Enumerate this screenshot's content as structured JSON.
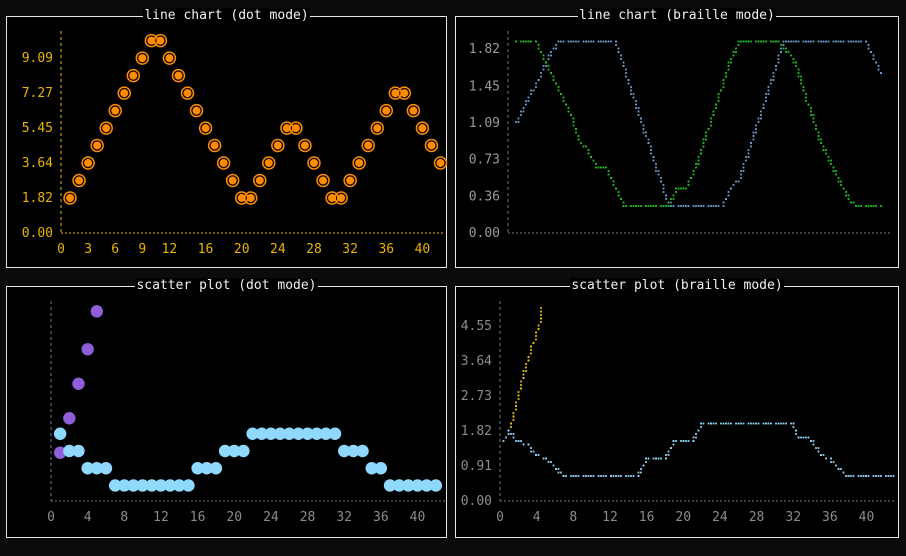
{
  "window": {
    "background": "#0b0b0c",
    "border": "#e6e6e6"
  },
  "panels": [
    {
      "title": "line chart (dot mode)",
      "chart_data": {
        "type": "line",
        "mode": "dot",
        "x": [
          1,
          2,
          3,
          4,
          5,
          6,
          7,
          8,
          9,
          10,
          11,
          12,
          13,
          14,
          15,
          16,
          17,
          18,
          19,
          20,
          21,
          22,
          23,
          24,
          25,
          26,
          27,
          28,
          29,
          30,
          31,
          32,
          33,
          34,
          35,
          36,
          37,
          38,
          39,
          40,
          41,
          42
        ],
        "series": [
          {
            "color": "#ff8c00",
            "values": [
              1.82,
              2.73,
              3.64,
              4.55,
              5.45,
              6.36,
              7.27,
              8.18,
              9.09,
              10.0,
              10.0,
              9.09,
              8.18,
              7.27,
              6.36,
              5.45,
              4.55,
              3.64,
              2.73,
              1.82,
              1.82,
              2.73,
              3.64,
              4.55,
              5.45,
              5.45,
              4.55,
              3.64,
              2.73,
              1.82,
              1.82,
              2.73,
              3.64,
              4.55,
              5.45,
              6.36,
              7.27,
              7.27,
              6.36,
              5.45,
              4.55,
              3.64
            ]
          }
        ],
        "x_ticks": [
          "0",
          "3",
          "6",
          "9",
          "12",
          "16",
          "20",
          "24",
          "28",
          "32",
          "36",
          "40"
        ],
        "x_tick_values": [
          0,
          3,
          6,
          9,
          12,
          16,
          20,
          24,
          28,
          32,
          36,
          40
        ],
        "y_ticks": [
          "0.00",
          "1.82",
          "3.64",
          "5.45",
          "7.27",
          "9.09"
        ],
        "y_tick_values": [
          0,
          1.82,
          3.64,
          5.45,
          7.27,
          9.09
        ],
        "xlim": [
          0,
          42.5
        ],
        "ylim": [
          0,
          10.5
        ],
        "axis_color": "#e8b400",
        "tick_color": "#e8b400"
      }
    },
    {
      "title": "line chart (braille mode)",
      "chart_data": {
        "type": "line",
        "mode": "braille",
        "x": [
          1,
          2,
          3,
          4,
          5,
          6,
          7,
          8,
          9,
          10,
          11,
          12,
          13,
          14,
          15,
          16,
          17,
          18,
          19,
          20,
          21,
          22,
          23,
          24,
          25,
          26,
          27,
          28,
          29,
          30,
          31,
          32,
          33,
          34,
          35,
          36,
          37,
          38,
          39,
          40,
          41,
          42
        ],
        "series": [
          {
            "color": "#6ea2d8",
            "values": [
              1.09,
              1.27,
              1.45,
              1.64,
              1.82,
              1.91,
              1.91,
              1.91,
              1.91,
              1.91,
              1.91,
              1.91,
              1.64,
              1.36,
              1.09,
              0.82,
              0.55,
              0.27,
              0.27,
              0.27,
              0.27,
              0.27,
              0.27,
              0.27,
              0.45,
              0.55,
              0.82,
              1.09,
              1.36,
              1.64,
              1.91,
              1.91,
              1.91,
              1.91,
              1.91,
              1.91,
              1.91,
              1.91,
              1.91,
              1.91,
              1.73,
              1.55
            ]
          },
          {
            "color": "#22c922",
            "values": [
              1.91,
              1.91,
              1.91,
              1.73,
              1.55,
              1.36,
              1.18,
              0.91,
              0.82,
              0.64,
              0.64,
              0.45,
              0.27,
              0.27,
              0.27,
              0.27,
              0.27,
              0.27,
              0.45,
              0.45,
              0.64,
              0.91,
              1.18,
              1.45,
              1.73,
              1.91,
              1.91,
              1.91,
              1.91,
              1.91,
              1.82,
              1.73,
              1.45,
              1.18,
              0.91,
              0.73,
              0.55,
              0.36,
              0.27,
              0.27,
              0.27,
              0.27
            ]
          }
        ],
        "y_ticks": [
          "0.00",
          "0.36",
          "0.73",
          "1.09",
          "1.45",
          "1.82"
        ],
        "y_tick_values": [
          0,
          0.36,
          0.73,
          1.09,
          1.45,
          1.82
        ],
        "xlim": [
          0,
          43
        ],
        "ylim": [
          0,
          2.0
        ],
        "axis_color": "#7a7a7a",
        "tick_color": "#9a9a9a"
      }
    },
    {
      "title": "scatter plot (dot mode)",
      "chart_data": {
        "type": "scatter",
        "mode": "dot",
        "series": [
          {
            "color": "#8e5fd9",
            "points": [
              [
                1,
                1.4
              ],
              [
                2,
                2.4
              ],
              [
                3,
                3.4
              ],
              [
                4,
                4.4
              ],
              [
                5,
                5.5
              ]
            ]
          },
          {
            "color": "#8fd9ff",
            "points": [
              [
                1,
                1.95
              ],
              [
                2,
                1.45
              ],
              [
                3,
                1.45
              ],
              [
                4,
                0.95
              ],
              [
                5,
                0.95
              ],
              [
                6,
                0.95
              ],
              [
                7,
                0.45
              ],
              [
                8,
                0.45
              ],
              [
                9,
                0.45
              ],
              [
                10,
                0.45
              ],
              [
                11,
                0.45
              ],
              [
                12,
                0.45
              ],
              [
                13,
                0.45
              ],
              [
                14,
                0.45
              ],
              [
                15,
                0.45
              ],
              [
                16,
                0.95
              ],
              [
                17,
                0.95
              ],
              [
                18,
                0.95
              ],
              [
                19,
                1.45
              ],
              [
                20,
                1.45
              ],
              [
                21,
                1.45
              ],
              [
                22,
                1.95
              ],
              [
                23,
                1.95
              ],
              [
                24,
                1.95
              ],
              [
                25,
                1.95
              ],
              [
                26,
                1.95
              ],
              [
                27,
                1.95
              ],
              [
                28,
                1.95
              ],
              [
                29,
                1.95
              ],
              [
                30,
                1.95
              ],
              [
                31,
                1.95
              ],
              [
                32,
                1.45
              ],
              [
                33,
                1.45
              ],
              [
                34,
                1.45
              ],
              [
                35,
                0.95
              ],
              [
                36,
                0.95
              ],
              [
                37,
                0.45
              ],
              [
                38,
                0.45
              ],
              [
                39,
                0.45
              ],
              [
                40,
                0.45
              ],
              [
                41,
                0.45
              ],
              [
                42,
                0.45
              ]
            ]
          }
        ],
        "x_ticks": [
          "0",
          "4",
          "8",
          "12",
          "16",
          "20",
          "24",
          "28",
          "32",
          "36",
          "40"
        ],
        "x_tick_values": [
          0,
          4,
          8,
          12,
          16,
          20,
          24,
          28,
          32,
          36,
          40
        ],
        "xlim": [
          0,
          43
        ],
        "ylim": [
          0,
          5.8
        ],
        "axis_color": "#7a7a7a",
        "tick_color": "#8c8c8c"
      }
    },
    {
      "title": "scatter plot (braille mode)",
      "chart_data": {
        "type": "scatter",
        "mode": "braille",
        "series": [
          {
            "color": "#f2c200",
            "points": [
              [
                1,
                1.82
              ],
              [
                1.5,
                2.2
              ],
              [
                2,
                2.73
              ],
              [
                2.5,
                3.2
              ],
              [
                3,
                3.64
              ],
              [
                3.5,
                4.0
              ],
              [
                4,
                4.35
              ],
              [
                4.5,
                4.75
              ],
              [
                4.6,
                5.0
              ]
            ]
          },
          {
            "color": "#8fd9ff",
            "points": [
              [
                0.5,
                1.6
              ],
              [
                1,
                1.82
              ],
              [
                2,
                1.55
              ],
              [
                3,
                1.45
              ],
              [
                4,
                1.2
              ],
              [
                5,
                1.09
              ],
              [
                6,
                0.85
              ],
              [
                7,
                0.68
              ],
              [
                8,
                0.64
              ],
              [
                12,
                0.64
              ],
              [
                15,
                0.64
              ],
              [
                16,
                1.09
              ],
              [
                17,
                1.09
              ],
              [
                18,
                1.09
              ],
              [
                19,
                1.55
              ],
              [
                20,
                1.55
              ],
              [
                21,
                1.55
              ],
              [
                22,
                2.0
              ],
              [
                23,
                2.0
              ],
              [
                26,
                2.0
              ],
              [
                29,
                2.0
              ],
              [
                32,
                2.0
              ],
              [
                32.5,
                1.65
              ],
              [
                34,
                1.6
              ],
              [
                35,
                1.2
              ],
              [
                36,
                1.09
              ],
              [
                37,
                0.85
              ],
              [
                38,
                0.64
              ],
              [
                40,
                0.64
              ],
              [
                43,
                0.64
              ]
            ]
          }
        ],
        "x_ticks": [
          "0",
          "4",
          "8",
          "12",
          "16",
          "20",
          "24",
          "28",
          "32",
          "36",
          "40"
        ],
        "x_tick_values": [
          0,
          4,
          8,
          12,
          16,
          20,
          24,
          28,
          32,
          36,
          40
        ],
        "y_ticks": [
          "0.00",
          "0.91",
          "1.82",
          "2.73",
          "3.64",
          "4.55"
        ],
        "y_tick_values": [
          0,
          0.91,
          1.82,
          2.73,
          3.64,
          4.55
        ],
        "xlim": [
          0,
          43
        ],
        "ylim": [
          0,
          5.2
        ],
        "axis_color": "#7a7a7a",
        "tick_color": "#8c8c8c"
      }
    }
  ]
}
